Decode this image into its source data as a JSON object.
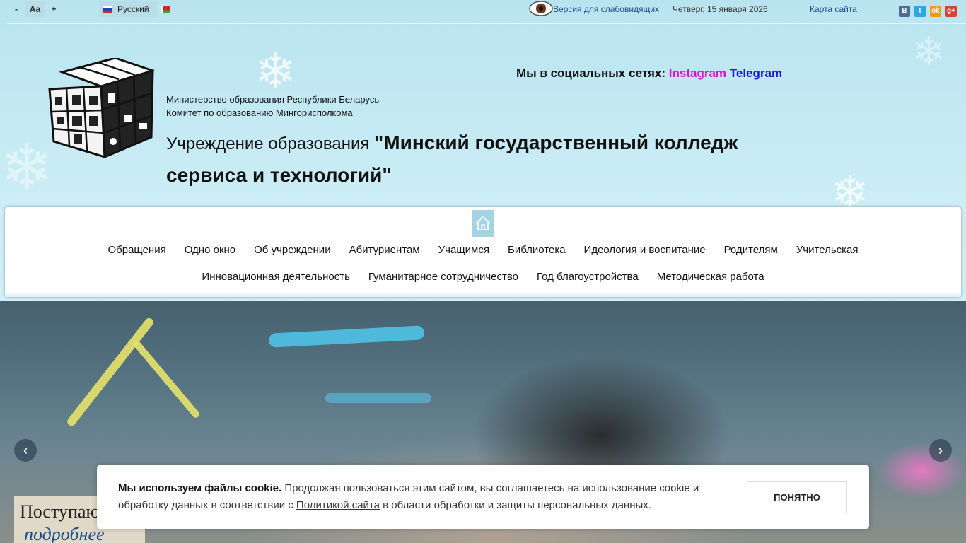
{
  "topbar": {
    "font_minus": "-",
    "font_normal": "Aa",
    "font_plus": "+",
    "language": "Русский",
    "low_vision_link": "Версия для слабовидящих",
    "date": "Четверг, 15 января 2026",
    "sitemap_link": "Карта сайта",
    "share": {
      "vk": "B",
      "twitter": "t",
      "ok": "ok",
      "gplus": "g+"
    }
  },
  "header": {
    "social_prefix": "Мы в социальных сетях:",
    "social_instagram": "Instagram",
    "social_telegram": "Telegram",
    "ministry_line1": "Министерство образования Республики Беларусь",
    "ministry_line2": "Комитет по образованию Мингорисполкома",
    "title_prefix": "Учреждение образования",
    "title_name": "\"Минский государственный колледж сервиса и технологий\""
  },
  "menu": {
    "row1": [
      "Обращения",
      "Одно окно",
      "Об учреждении",
      "Абитуриентам",
      "Учащимся",
      "Библиотека",
      "Идеология и воспитание",
      "Родителям",
      "Учительская"
    ],
    "row2": [
      "Инновационная деятельность",
      "Гуманитарное сотрудничество",
      "Год благоустройства",
      "Методическая работа"
    ]
  },
  "slider": {
    "prev": "‹",
    "next": "›",
    "caption_title": "Поступаю",
    "caption_more": "подробнее"
  },
  "cookie": {
    "bold": "Мы используем файлы cookie.",
    "text1": "Продолжая пользоваться этим сайтом, вы соглашаетесь на использование cookie и обработку данных в соответствии с",
    "link": "Политикой сайта",
    "text2": "в области обработки и защиты персональных данных.",
    "button": "ПОНЯТНО"
  }
}
